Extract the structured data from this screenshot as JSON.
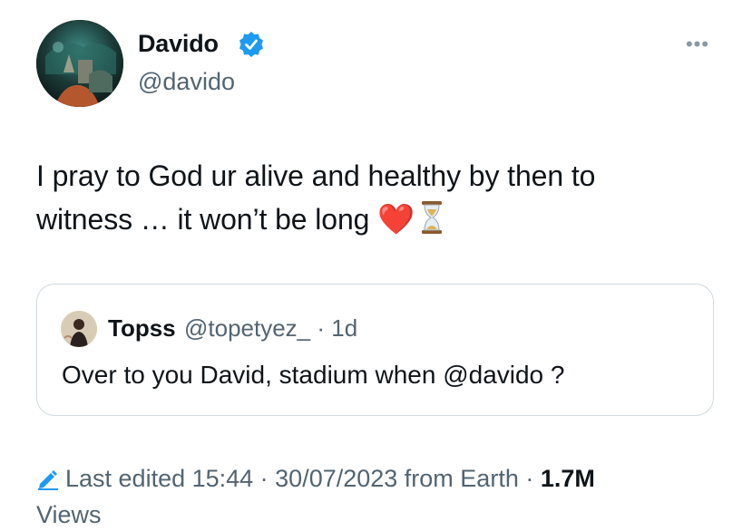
{
  "author": {
    "name": "Davido",
    "handle": "@davido",
    "verified": true,
    "badge_color": "#1d9bf0"
  },
  "tweet": {
    "line1": "I pray to God ur alive and healthy by then to",
    "line2": "witness  … it won’t be long",
    "heart": "❤️"
  },
  "quoted": {
    "name": "Topss",
    "handle_time": "@topetyez_ · 1d",
    "text": "Over to you David, stadium when @davido ?"
  },
  "meta": {
    "edited": "Last edited 15:44 · 30/07/2023",
    "source": " from Earth · ",
    "views_count": "1.7M",
    "views_label": "Views"
  },
  "icons": [
    "verified-badge-icon",
    "more-options-icon",
    "edit-pencil-icon",
    "hourglass-icon",
    "heart-emoji"
  ],
  "colors": {
    "text": "#0f1419",
    "muted": "#536471",
    "border": "#cfd9de",
    "accent": "#1d9bf0"
  }
}
